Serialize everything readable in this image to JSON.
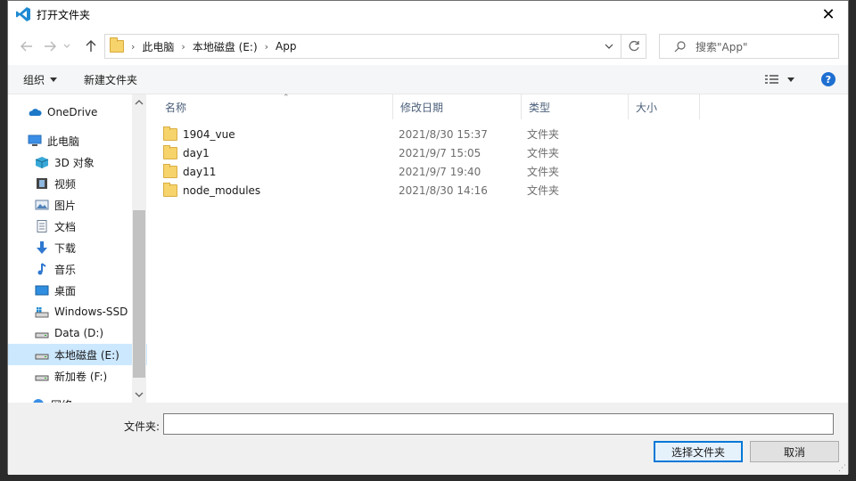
{
  "window": {
    "title": "打开文件夹",
    "close_glyph": "✕"
  },
  "nav": {
    "breadcrumb": [
      "此电脑",
      "本地磁盘 (E:)",
      "App"
    ],
    "search_placeholder": "搜索\"App\""
  },
  "toolbar": {
    "organize_label": "组织",
    "new_folder_label": "新建文件夹",
    "help_glyph": "?"
  },
  "sidebar": {
    "items": [
      {
        "label": "OneDrive",
        "icon": "cloud-icon"
      },
      {
        "label": "此电脑",
        "icon": "computer-icon"
      },
      {
        "label": "3D 对象",
        "icon": "cube-icon"
      },
      {
        "label": "视频",
        "icon": "video-icon"
      },
      {
        "label": "图片",
        "icon": "picture-icon"
      },
      {
        "label": "文档",
        "icon": "document-icon"
      },
      {
        "label": "下载",
        "icon": "download-icon"
      },
      {
        "label": "音乐",
        "icon": "music-icon"
      },
      {
        "label": "桌面",
        "icon": "desktop-icon"
      },
      {
        "label": "Windows-SSD",
        "icon": "drive-icon"
      },
      {
        "label": "Data (D:)",
        "icon": "drive-icon"
      },
      {
        "label": "本地磁盘 (E:)",
        "icon": "drive-icon",
        "selected": true
      },
      {
        "label": "新加卷 (F:)",
        "icon": "drive-icon"
      },
      {
        "label": "网络",
        "icon": "network-icon"
      }
    ]
  },
  "files": {
    "columns": [
      "名称",
      "修改日期",
      "类型",
      "大小"
    ],
    "rows": [
      {
        "name": "1904_vue",
        "date": "2021/8/30 15:37",
        "type": "文件夹"
      },
      {
        "name": "day1",
        "date": "2021/9/7 15:05",
        "type": "文件夹"
      },
      {
        "name": "day11",
        "date": "2021/9/7 19:40",
        "type": "文件夹"
      },
      {
        "name": "node_modules",
        "date": "2021/8/30 14:16",
        "type": "文件夹"
      }
    ]
  },
  "footer": {
    "folder_label": "文件夹:",
    "folder_value": "",
    "select_button": "选择文件夹",
    "cancel_button": "取消"
  },
  "colors": {
    "accent": "#0078d7",
    "selection": "#cce8ff",
    "folder": "#f7d36b",
    "help": "#1e6fd1"
  }
}
